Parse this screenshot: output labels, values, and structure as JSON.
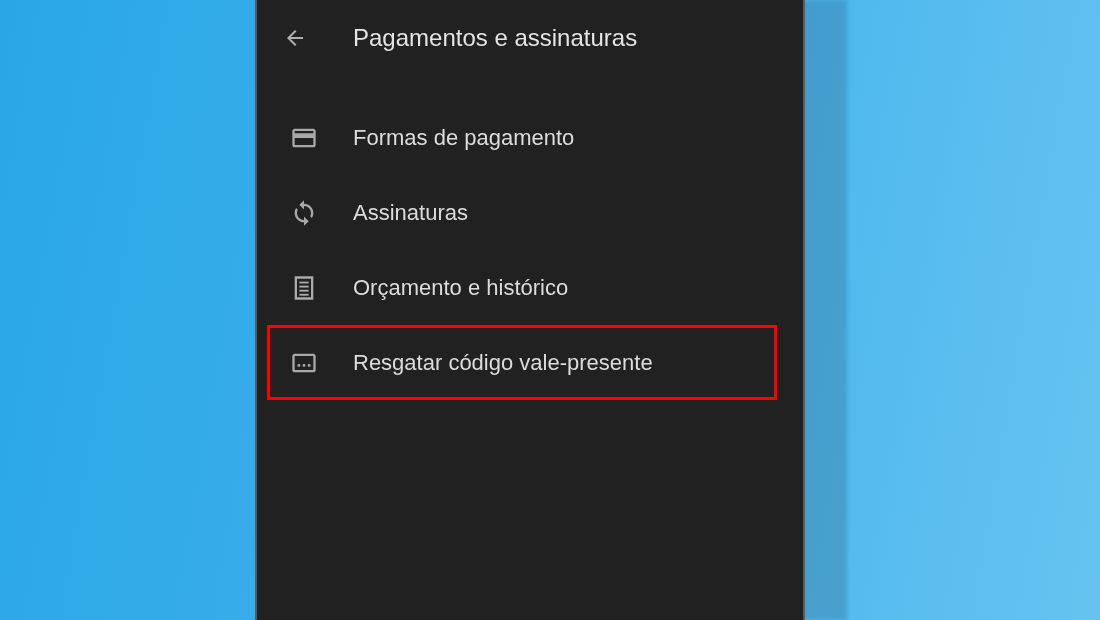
{
  "screen": {
    "title": "Pagamentos e assinaturas"
  },
  "menu_items": [
    {
      "label": "Formas de pagamento",
      "highlighted": false
    },
    {
      "label": "Assinaturas",
      "highlighted": false
    },
    {
      "label": "Orçamento e histórico",
      "highlighted": false
    },
    {
      "label": "Resgatar código vale-presente",
      "highlighted": true
    }
  ]
}
